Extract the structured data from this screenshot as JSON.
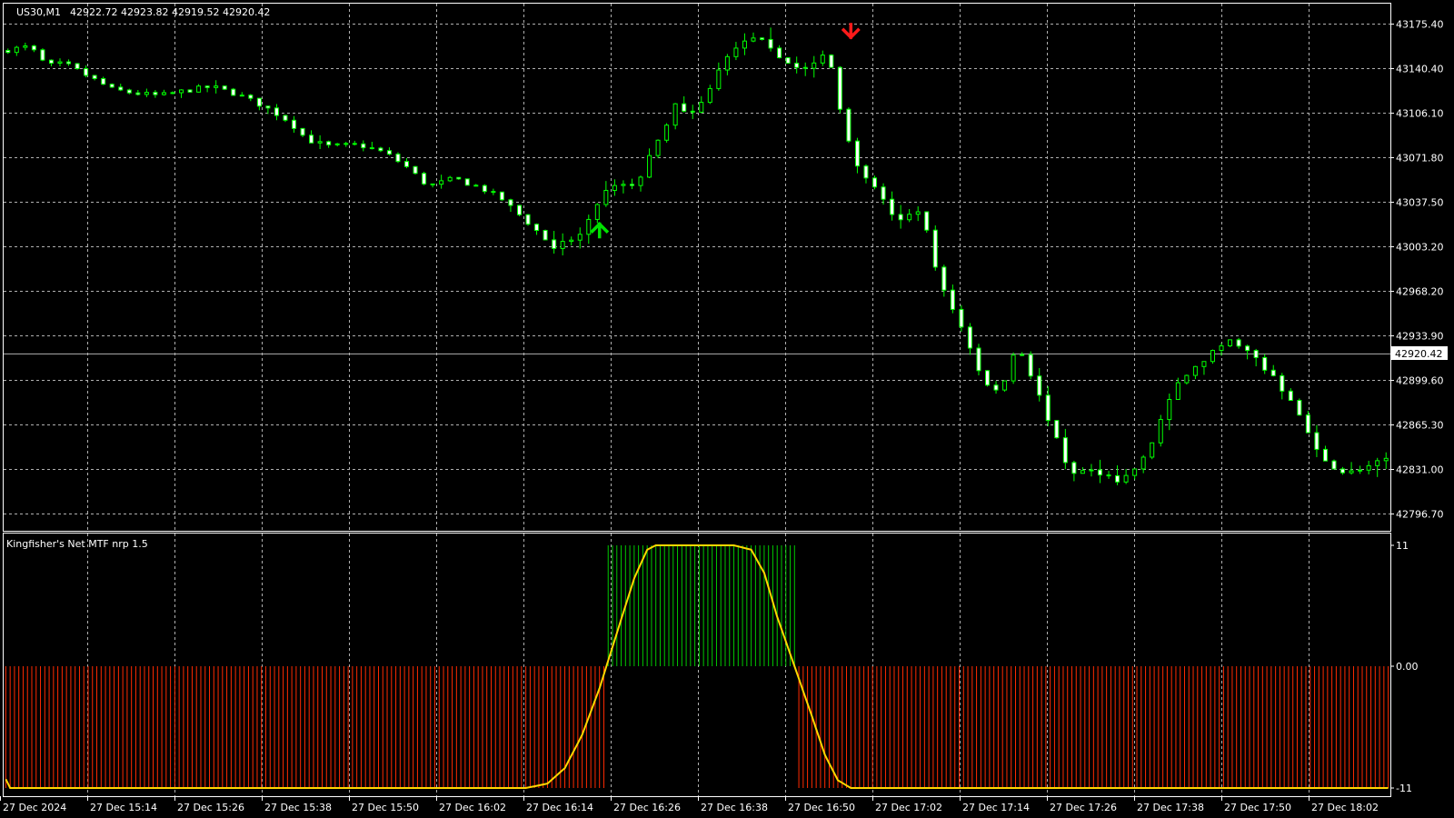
{
  "header": {
    "symbol": "US30,M1",
    "ohlc": "42922.72 42923.82 42919.52 42920.42"
  },
  "indicator": {
    "name": "Kingfisher's Net MTF nrp 1.5",
    "scale_labels": [
      "11",
      "0.00",
      "-11"
    ]
  },
  "colors": {
    "background": "#000000",
    "frame": "#ffffff",
    "grid": "#b0b0b0",
    "candle": "#00ff00",
    "candle_body_bull": "#000000",
    "candle_body_bear": "#ffffff",
    "buy_arrow": "#00e000",
    "sell_arrow": "#ff1a1a",
    "price_line": "#b0b0b0",
    "hist_negative": "#ff2a00",
    "hist_positive": "#00c800",
    "signal_line": "#ffd700"
  },
  "current_price": "42920.42",
  "chart_data": [
    {
      "type": "candlestick",
      "title": "US30,M1",
      "ylim": [
        42780.0,
        43190.0
      ],
      "y_ticks": [
        "43175.40",
        "43140.40",
        "43106.10",
        "43071.80",
        "43037.50",
        "43003.20",
        "42968.20",
        "42933.90",
        "42899.60",
        "42865.30",
        "42831.00",
        "42796.70"
      ],
      "x_ticks": [
        "27 Dec 2024",
        "27 Dec 15:14",
        "27 Dec 15:26",
        "27 Dec 15:38",
        "27 Dec 15:50",
        "27 Dec 16:02",
        "27 Dec 16:14",
        "27 Dec 16:26",
        "27 Dec 16:38",
        "27 Dec 16:50",
        "27 Dec 17:02",
        "27 Dec 17:14",
        "27 Dec 17:26",
        "27 Dec 17:38",
        "27 Dec 17:50",
        "27 Dec 18:02"
      ],
      "grid": true,
      "close_path": [
        [
          0,
          43155
        ],
        [
          6,
          43158
        ],
        [
          10,
          43143
        ],
        [
          14,
          43145
        ],
        [
          19,
          43136
        ],
        [
          25,
          43125
        ],
        [
          30,
          43122
        ],
        [
          36,
          43120
        ],
        [
          42,
          43124
        ],
        [
          48,
          43127
        ],
        [
          54,
          43121
        ],
        [
          60,
          43112
        ],
        [
          66,
          43100
        ],
        [
          70,
          43086
        ],
        [
          75,
          43081
        ],
        [
          82,
          43082
        ],
        [
          88,
          43076
        ],
        [
          93,
          43065
        ],
        [
          98,
          43050
        ],
        [
          104,
          43056
        ],
        [
          110,
          43049
        ],
        [
          115,
          43040
        ],
        [
          121,
          43022
        ],
        [
          127,
          43003
        ],
        [
          133,
          43012
        ],
        [
          137,
          43034
        ],
        [
          140,
          43052
        ],
        [
          146,
          43050
        ],
        [
          150,
          43080
        ],
        [
          155,
          43112
        ],
        [
          160,
          43107
        ],
        [
          165,
          43141
        ],
        [
          170,
          43160
        ],
        [
          175,
          43165
        ],
        [
          180,
          43147
        ],
        [
          186,
          43140
        ],
        [
          190,
          43157
        ],
        [
          194,
          43096
        ],
        [
          198,
          43058
        ],
        [
          202,
          43047
        ],
        [
          206,
          43023
        ],
        [
          212,
          43030
        ],
        [
          216,
          42975
        ],
        [
          222,
          42935
        ],
        [
          226,
          42898
        ],
        [
          230,
          42890
        ],
        [
          234,
          42930
        ],
        [
          238,
          42896
        ],
        [
          242,
          42862
        ],
        [
          246,
          42829
        ],
        [
          252,
          42830
        ],
        [
          258,
          42822
        ],
        [
          264,
          42843
        ],
        [
          268,
          42879
        ],
        [
          272,
          42902
        ],
        [
          278,
          42918
        ],
        [
          282,
          42932
        ],
        [
          287,
          42922
        ],
        [
          292,
          42906
        ],
        [
          298,
          42880
        ],
        [
          304,
          42838
        ],
        [
          310,
          42828
        ],
        [
          316,
          42835
        ],
        [
          319,
          42838
        ]
      ],
      "signals": [
        {
          "type": "buy",
          "bar": 137,
          "price": 43018
        },
        {
          "type": "sell",
          "bar": 195,
          "price": 43168
        }
      ]
    },
    {
      "type": "histogram",
      "title": "Kingfisher's Net MTF nrp 1.5",
      "ylim": [
        -11,
        11
      ],
      "series": [
        {
          "values_path": [
            [
              0,
              -10.2
            ],
            [
              1,
              -11
            ],
            [
              120,
              -11
            ],
            [
              125,
              -10.6
            ],
            [
              129,
              -9.2
            ],
            [
              133,
              -6.2
            ],
            [
              137,
              -2.0
            ],
            [
              141,
              3.0
            ],
            [
              145,
              8.0
            ],
            [
              148,
              10.6
            ],
            [
              150,
              11
            ],
            [
              168,
              11
            ],
            [
              172,
              10.6
            ],
            [
              175,
              8.5
            ],
            [
              178,
              4.5
            ],
            [
              182,
              0.0
            ],
            [
              186,
              -4.5
            ],
            [
              189,
              -8.0
            ],
            [
              192,
              -10.3
            ],
            [
              195,
              -11
            ],
            [
              318,
              -11
            ]
          ]
        }
      ]
    }
  ]
}
